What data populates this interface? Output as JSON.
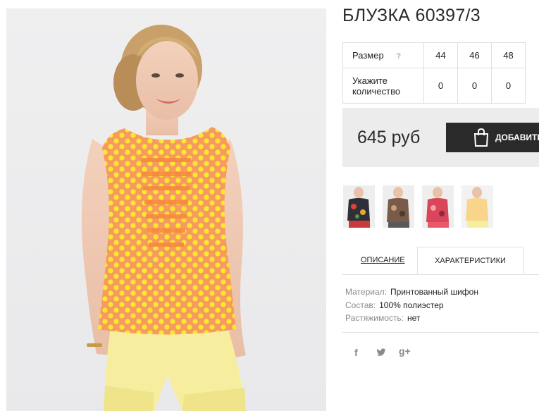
{
  "product": {
    "title": "БЛУЗКА 60397/3"
  },
  "size_table": {
    "size_label": "Размер",
    "help_mark": "?",
    "sizes": [
      "44",
      "46",
      "48"
    ],
    "quantity_label_line1": "Укажите",
    "quantity_label_line2": "количество",
    "quantities": [
      "0",
      "0",
      "0"
    ]
  },
  "purchase": {
    "price": "645 руб",
    "add_button_label": "ДОБАВИТЬ"
  },
  "thumbnails": [
    {
      "name": "thumb-dark-floral"
    },
    {
      "name": "thumb-print-bronze"
    },
    {
      "name": "thumb-red-print"
    },
    {
      "name": "thumb-yellow-polka"
    }
  ],
  "tabs": {
    "description": "ОПИСАНИЕ",
    "characteristics": "ХАРАКТЕРИСТИКИ"
  },
  "specs": [
    {
      "key": "Материал:",
      "value": "Принтованный шифон"
    },
    {
      "key": "Состав:",
      "value": "100% полиэстер"
    },
    {
      "key": "Растяжимость:",
      "value": "нет"
    }
  ],
  "social": {
    "icons": [
      "facebook-icon",
      "twitter-icon",
      "google-plus-icon"
    ],
    "facebook": "f",
    "google_plus": "g+"
  },
  "colors": {
    "blouse": "#f5a15e",
    "dots": "#ffe92e",
    "shorts": "#f6ee9e",
    "button": "#2a2a2a",
    "price_box": "#ececec"
  }
}
